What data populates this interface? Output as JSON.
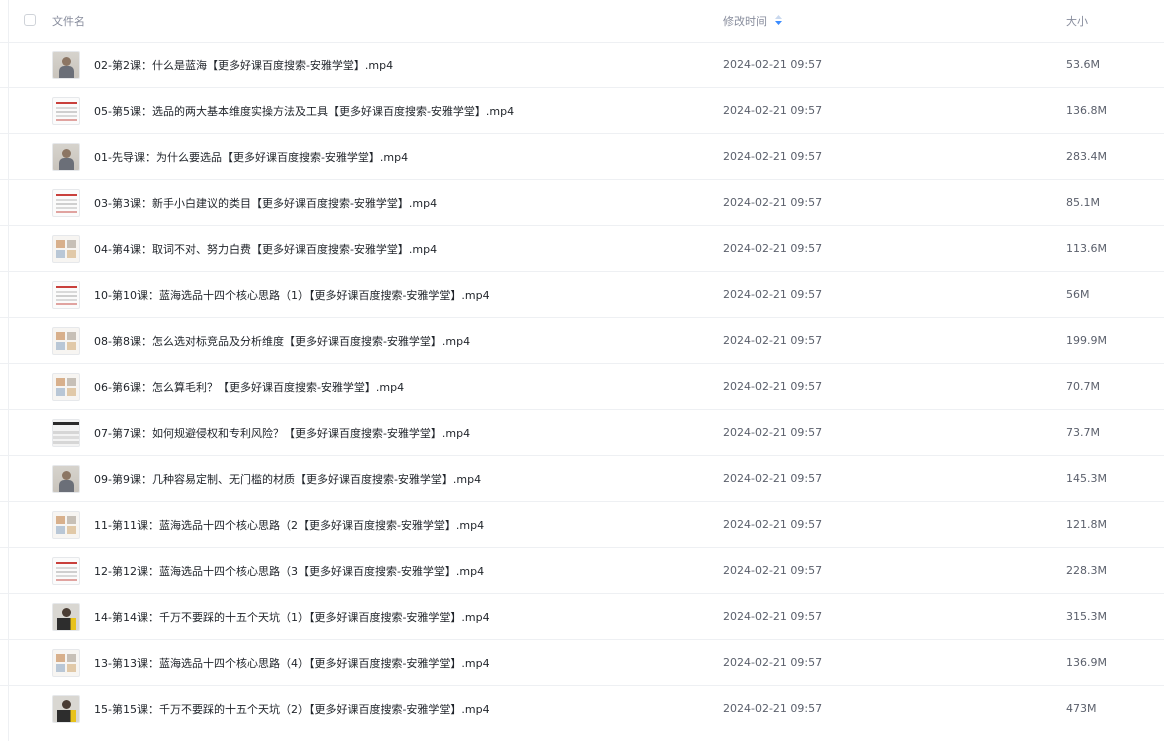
{
  "header": {
    "name_label": "文件名",
    "modified_label": "修改时间",
    "size_label": "大小"
  },
  "files": [
    {
      "name": "02-第2课：什么是蓝海【更多好课百度搜索-安雅学堂】.mp4",
      "modified": "2024-02-21 09:57",
      "size": "53.6M",
      "thumb": "person"
    },
    {
      "name": "05-第5课：选品的两大基本维度实操方法及工具【更多好课百度搜索-安雅学堂】.mp4",
      "modified": "2024-02-21 09:57",
      "size": "136.8M",
      "thumb": "doc"
    },
    {
      "name": "01-先导课：为什么要选品【更多好课百度搜索-安雅学堂】.mp4",
      "modified": "2024-02-21 09:57",
      "size": "283.4M",
      "thumb": "person"
    },
    {
      "name": "03-第3课：新手小白建议的类目【更多好课百度搜索-安雅学堂】.mp4",
      "modified": "2024-02-21 09:57",
      "size": "85.1M",
      "thumb": "doc"
    },
    {
      "name": "04-第4课：取词不对、努力白费【更多好课百度搜索-安雅学堂】.mp4",
      "modified": "2024-02-21 09:57",
      "size": "113.6M",
      "thumb": "grid"
    },
    {
      "name": "10-第10课：蓝海选品十四个核心思路（1）【更多好课百度搜索-安雅学堂】.mp4",
      "modified": "2024-02-21 09:57",
      "size": "56M",
      "thumb": "doc"
    },
    {
      "name": "08-第8课：怎么选对标竞品及分析维度【更多好课百度搜索-安雅学堂】.mp4",
      "modified": "2024-02-21 09:57",
      "size": "199.9M",
      "thumb": "grid"
    },
    {
      "name": "06-第6课：怎么算毛利？【更多好课百度搜索-安雅学堂】.mp4",
      "modified": "2024-02-21 09:57",
      "size": "70.7M",
      "thumb": "grid"
    },
    {
      "name": "07-第7课：如何规避侵权和专利风险？【更多好课百度搜索-安雅学堂】.mp4",
      "modified": "2024-02-21 09:57",
      "size": "73.7M",
      "thumb": "dark"
    },
    {
      "name": "09-第9课：几种容易定制、无门槛的材质【更多好课百度搜索-安雅学堂】.mp4",
      "modified": "2024-02-21 09:57",
      "size": "145.3M",
      "thumb": "person"
    },
    {
      "name": "11-第11课：蓝海选品十四个核心思路（2【更多好课百度搜索-安雅学堂】.mp4",
      "modified": "2024-02-21 09:57",
      "size": "121.8M",
      "thumb": "grid"
    },
    {
      "name": "12-第12课：蓝海选品十四个核心思路（3【更多好课百度搜索-安雅学堂】.mp4",
      "modified": "2024-02-21 09:57",
      "size": "228.3M",
      "thumb": "doc"
    },
    {
      "name": "14-第14课：千万不要踩的十五个天坑（1）【更多好课百度搜索-安雅学堂】.mp4",
      "modified": "2024-02-21 09:57",
      "size": "315.3M",
      "thumb": "yellow"
    },
    {
      "name": "13-第13课：蓝海选品十四个核心思路（4）【更多好课百度搜索-安雅学堂】.mp4",
      "modified": "2024-02-21 09:57",
      "size": "136.9M",
      "thumb": "grid"
    },
    {
      "name": "15-第15课：千万不要踩的十五个天坑（2）【更多好课百度搜索-安雅学堂】.mp4",
      "modified": "2024-02-21 09:57",
      "size": "473M",
      "thumb": "yellow"
    }
  ],
  "colors": {
    "sort_accent": "#3b8cff"
  }
}
